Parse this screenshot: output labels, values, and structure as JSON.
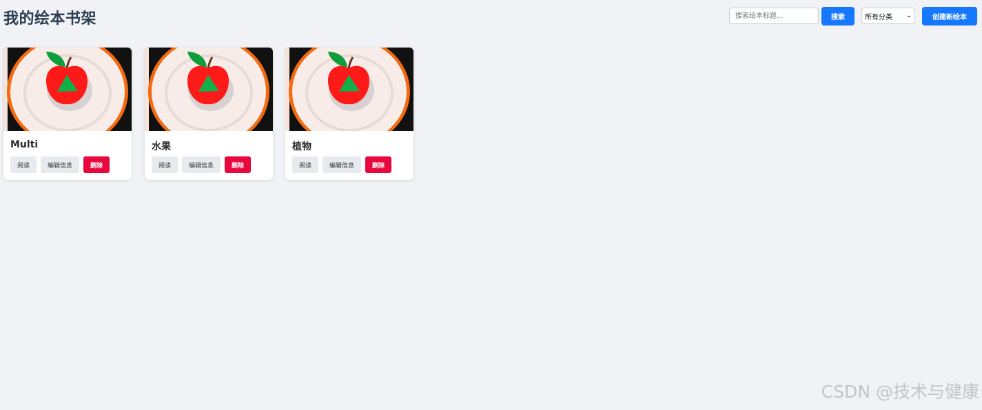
{
  "header": {
    "title": "我的绘本书架"
  },
  "toolbar": {
    "search_placeholder": "搜索绘本标题...",
    "search_value": "",
    "search_label": "搜索",
    "category_selected": "所有分类",
    "create_label": "创建新绘本"
  },
  "books": [
    {
      "title": "Multi",
      "read_label": "阅读",
      "edit_label": "编辑信息",
      "delete_label": "删除"
    },
    {
      "title": "水果",
      "read_label": "阅读",
      "edit_label": "编辑信息",
      "delete_label": "删除"
    },
    {
      "title": "植物",
      "read_label": "阅读",
      "edit_label": "编辑信息",
      "delete_label": "删除"
    }
  ],
  "colors": {
    "primary": "#1677ff",
    "danger": "#e8083e",
    "background": "#f0f2f5"
  },
  "watermark": "CSDN @技术与健康"
}
